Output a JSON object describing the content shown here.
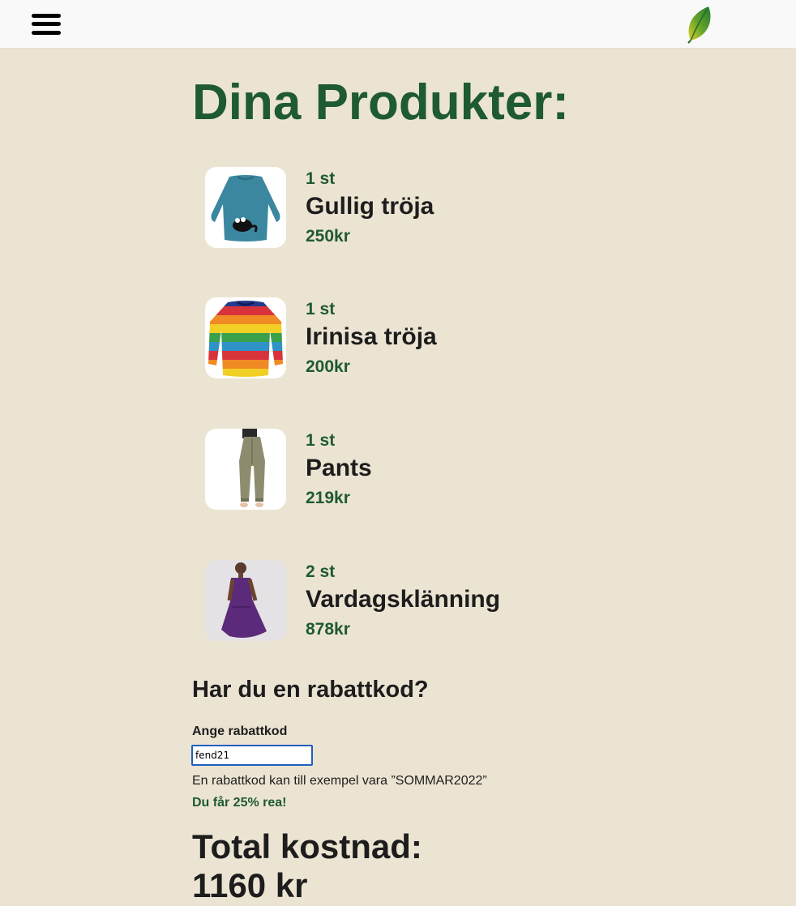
{
  "header": {
    "menu_icon": "hamburger-menu-icon",
    "logo_icon": "leaf-icon"
  },
  "page": {
    "title": "Dina Produkter:"
  },
  "products": [
    {
      "qty": "1 st",
      "name": "Gullig tröja",
      "price": "250kr",
      "image": "teal-cat-sweater"
    },
    {
      "qty": "1 st",
      "name": "Irinisa tröja",
      "price": "200kr",
      "image": "rainbow-striped-sweater"
    },
    {
      "qty": "1 st",
      "name": "Pants",
      "price": "219kr",
      "image": "olive-pants"
    },
    {
      "qty": "2 st",
      "name": "Vardagsklänning",
      "price": "878kr",
      "image": "purple-dress"
    }
  ],
  "discount": {
    "heading": "Har du en rabattkod?",
    "label": "Ange rabattkod",
    "value": "fend21",
    "hint": "En rabattkod kan till exempel vara ”SOMMAR2022”",
    "success": "Du får 25% rea!"
  },
  "total": {
    "heading": "Total kostnad:",
    "value": "1160 kr"
  },
  "colors": {
    "background": "#ece4d2",
    "header_bg": "#f9f9f9",
    "accent_green": "#1e5a32",
    "text_dark": "#1d1d1d",
    "input_border": "#1f5fbf"
  }
}
